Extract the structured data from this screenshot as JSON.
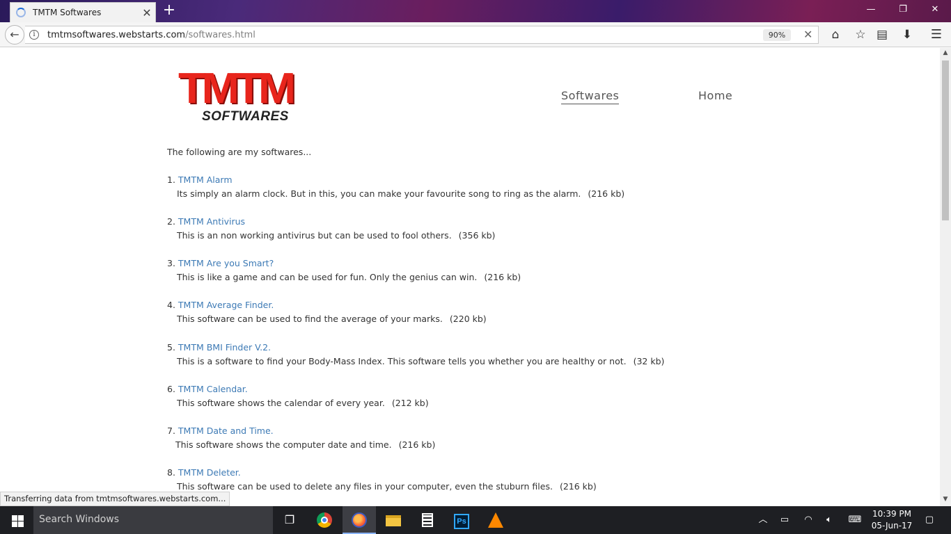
{
  "browser": {
    "tab_title": "TMTM Softwares",
    "tab_close": "✕",
    "new_tab": "+",
    "url_host": "tmtmsoftwares.webstarts.com",
    "url_path": "/softwares.html",
    "url_prefix": "",
    "zoom": "90%",
    "url_clear": "✕",
    "status": "Transferring data from tmtmsoftwares.webstarts.com..."
  },
  "site": {
    "logo_main": "TMTM",
    "logo_sub": "SOFTWARES",
    "nav": [
      {
        "label": "Softwares"
      },
      {
        "label": "Home"
      }
    ],
    "intro": "The following are my softwares...",
    "items": [
      {
        "num": "1.",
        "title": "TMTM Alarm",
        "desc": "Its simply an alarm clock. But in this, you can make your favourite song to ring as the alarm.",
        "size": "(216 kb)"
      },
      {
        "num": "2.",
        "title": "TMTM Antivirus",
        "desc": "This is an non working antivirus but can be used to fool others.",
        "size": "(356 kb)"
      },
      {
        "num": "3.",
        "title": "TMTM Are you Smart?",
        "desc": "This is like a game and can be used for fun. Only the genius can win.",
        "size": "(216 kb)"
      },
      {
        "num": "4.",
        "title": "TMTM Average Finder.",
        "desc": "This software can be used to find the average of your marks.",
        "size": "(220 kb)"
      },
      {
        "num": "5.",
        "title": "TMTM BMI Finder V.2.",
        "desc": "This is a software to find your Body-Mass Index. This software tells you whether you are healthy or not.",
        "size": "(32 kb)"
      },
      {
        "num": "6.",
        "title": "TMTM Calendar.",
        "desc": "This software shows the calendar of every year.",
        "size": "(212 kb)"
      },
      {
        "num": "7.",
        "title": "TMTM Date and Time.",
        "desc": "This software shows the computer date and time.",
        "size": "(216 kb)"
      },
      {
        "num": "8.",
        "title": "TMTM Deleter.",
        "desc": "This software can be used to delete any files in your computer, even the stuburn files.",
        "size": "(216 kb)"
      }
    ]
  },
  "taskbar": {
    "search_placeholder": "Search Windows",
    "ps_label": "Ps",
    "time": "10:39 PM",
    "date": "05-Jun-17"
  },
  "icons": {
    "back": "back-arrow-icon",
    "info": "info-icon",
    "home": "home-icon",
    "bookmark": "star-icon",
    "reader": "reader-list-icon",
    "download": "download-arrow-icon",
    "menu": "hamburger-menu-icon"
  },
  "colors": {
    "link": "#3d7ab5",
    "logo_red": "#e8251c",
    "taskbar": "#1e1f23"
  }
}
